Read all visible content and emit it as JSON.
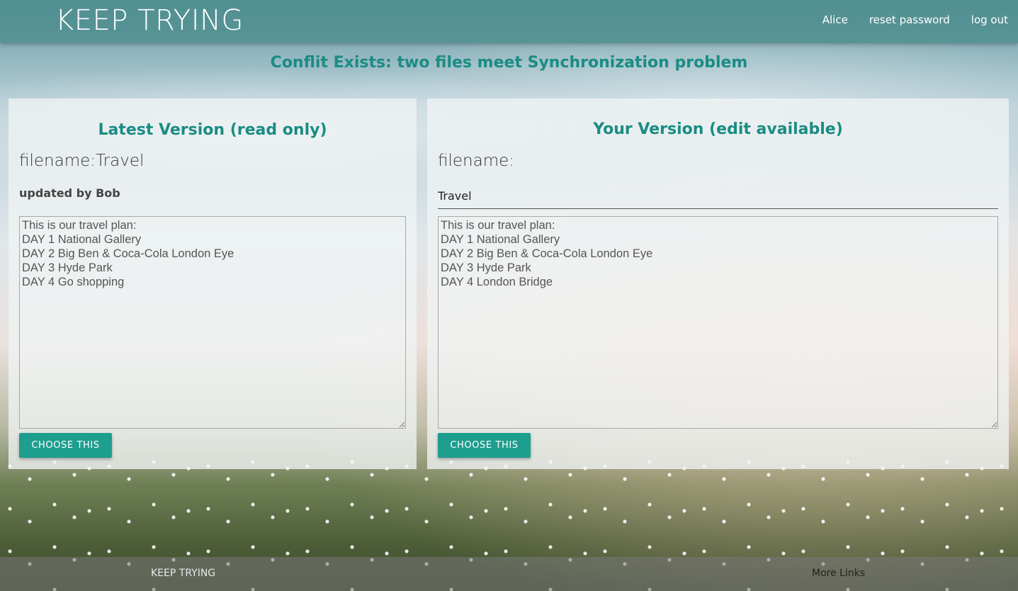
{
  "header": {
    "brand": "KEEP TRYING",
    "nav": {
      "user": "Alice",
      "reset_password": "reset password",
      "logout": "log out"
    }
  },
  "conflict_title": "Conflit Exists: two files meet Synchronization problem",
  "latest": {
    "title": "Latest Version (read only)",
    "filename_label": "filename:Travel",
    "updated_by": "updated by Bob",
    "content": "This is our travel plan:\nDAY 1 National Gallery\nDAY 2 Big Ben & Coca-Cola London Eye\nDAY 3 Hyde Park\nDAY 4 Go shopping",
    "button": "CHOOSE THIS"
  },
  "yours": {
    "title": "Your Version (edit available)",
    "filename_label": "filename:",
    "filename_value": "Travel",
    "content": "This is our travel plan:\nDAY 1 National Gallery\nDAY 2 Big Ben & Coca-Cola London Eye\nDAY 3 Hyde Park\nDAY 4 London Bridge",
    "button": "CHOOSE THIS"
  },
  "footer": {
    "brand": "KEEP TRYING",
    "more_links": "More Links"
  },
  "colors": {
    "accent": "#1e9e8f",
    "title": "#1a8c84",
    "header_bg": "#4a8c8c"
  }
}
